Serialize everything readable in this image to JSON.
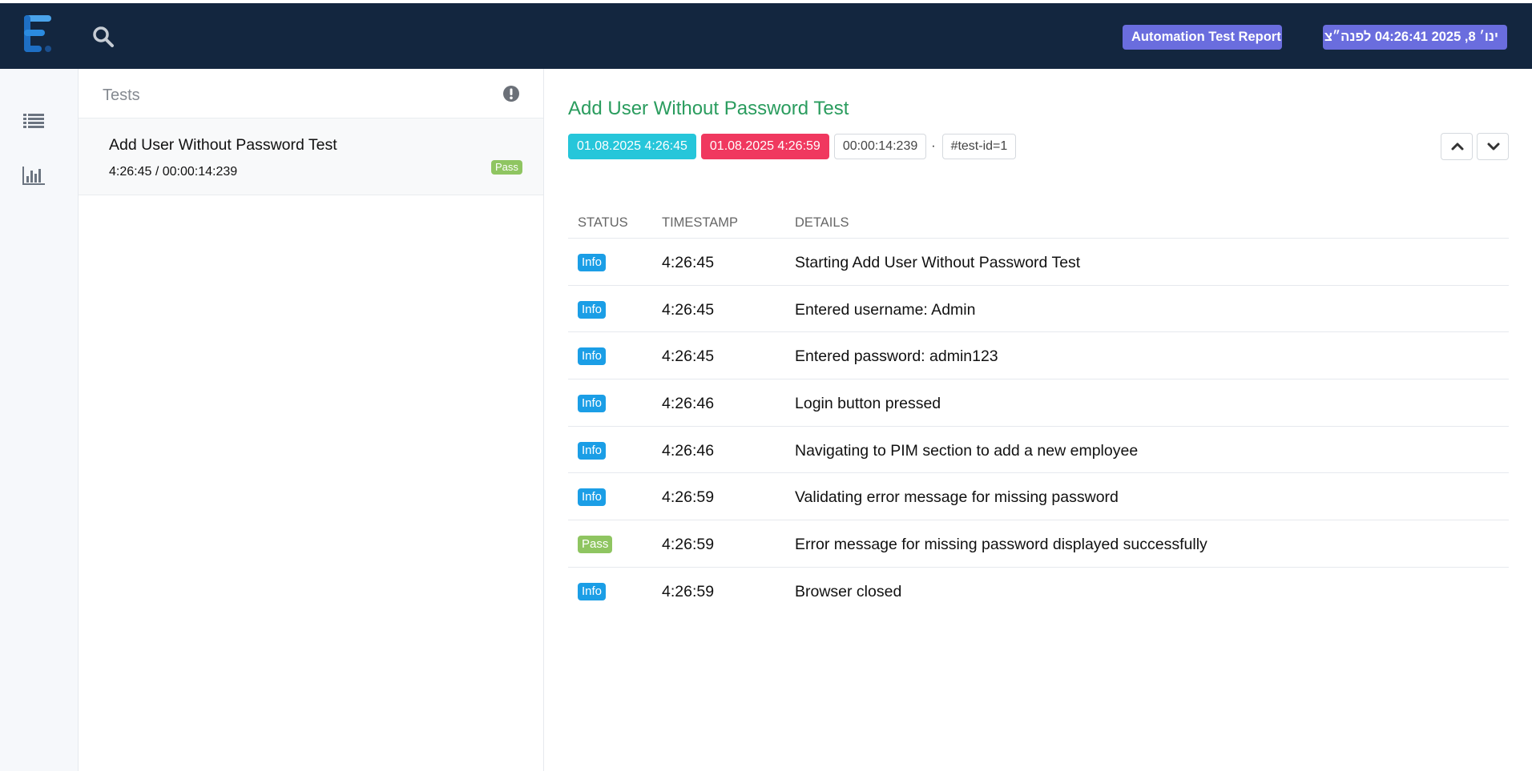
{
  "header": {
    "report_title": "Automation Test Report",
    "report_date": "ינו׳ 8, 2025 04:26:41 לפנה״צ"
  },
  "sidebar": {
    "items": [
      {
        "name": "test-list-nav",
        "icon": "list-icon"
      },
      {
        "name": "dashboard-nav",
        "icon": "bar-chart-icon"
      }
    ]
  },
  "tests_panel": {
    "title": "Tests",
    "items": [
      {
        "name": "Add User Without Password Test",
        "time": "4:26:45 / 00:00:14:239",
        "status": "Pass"
      }
    ]
  },
  "detail": {
    "title": "Add User Without Password Test",
    "start": "01.08.2025 4:26:45",
    "end": "01.08.2025 4:26:59",
    "duration": "00:00:14:239",
    "separator": "·",
    "test_id": "#test-id=1",
    "columns": {
      "status": "STATUS",
      "timestamp": "TIMESTAMP",
      "details": "DETAILS"
    },
    "logs": [
      {
        "status": "Info",
        "time": "4:26:45",
        "details": "Starting Add User Without Password Test"
      },
      {
        "status": "Info",
        "time": "4:26:45",
        "details": "Entered username: Admin"
      },
      {
        "status": "Info",
        "time": "4:26:45",
        "details": "Entered password: admin123"
      },
      {
        "status": "Info",
        "time": "4:26:46",
        "details": "Login button pressed"
      },
      {
        "status": "Info",
        "time": "4:26:46",
        "details": "Navigating to PIM section to add a new employee"
      },
      {
        "status": "Info",
        "time": "4:26:59",
        "details": "Validating error message for missing password"
      },
      {
        "status": "Pass",
        "time": "4:26:59",
        "details": "Error message for missing password displayed successfully"
      },
      {
        "status": "Info",
        "time": "4:26:59",
        "details": "Browser closed"
      }
    ]
  },
  "colors": {
    "navbar": "#13263f",
    "badge_header": "#6a6dde",
    "pass": "#8fc561",
    "info": "#1b9ee6",
    "start_chip": "#26c6da",
    "end_chip": "#f0385f",
    "title_green": "#2a9c5e"
  }
}
